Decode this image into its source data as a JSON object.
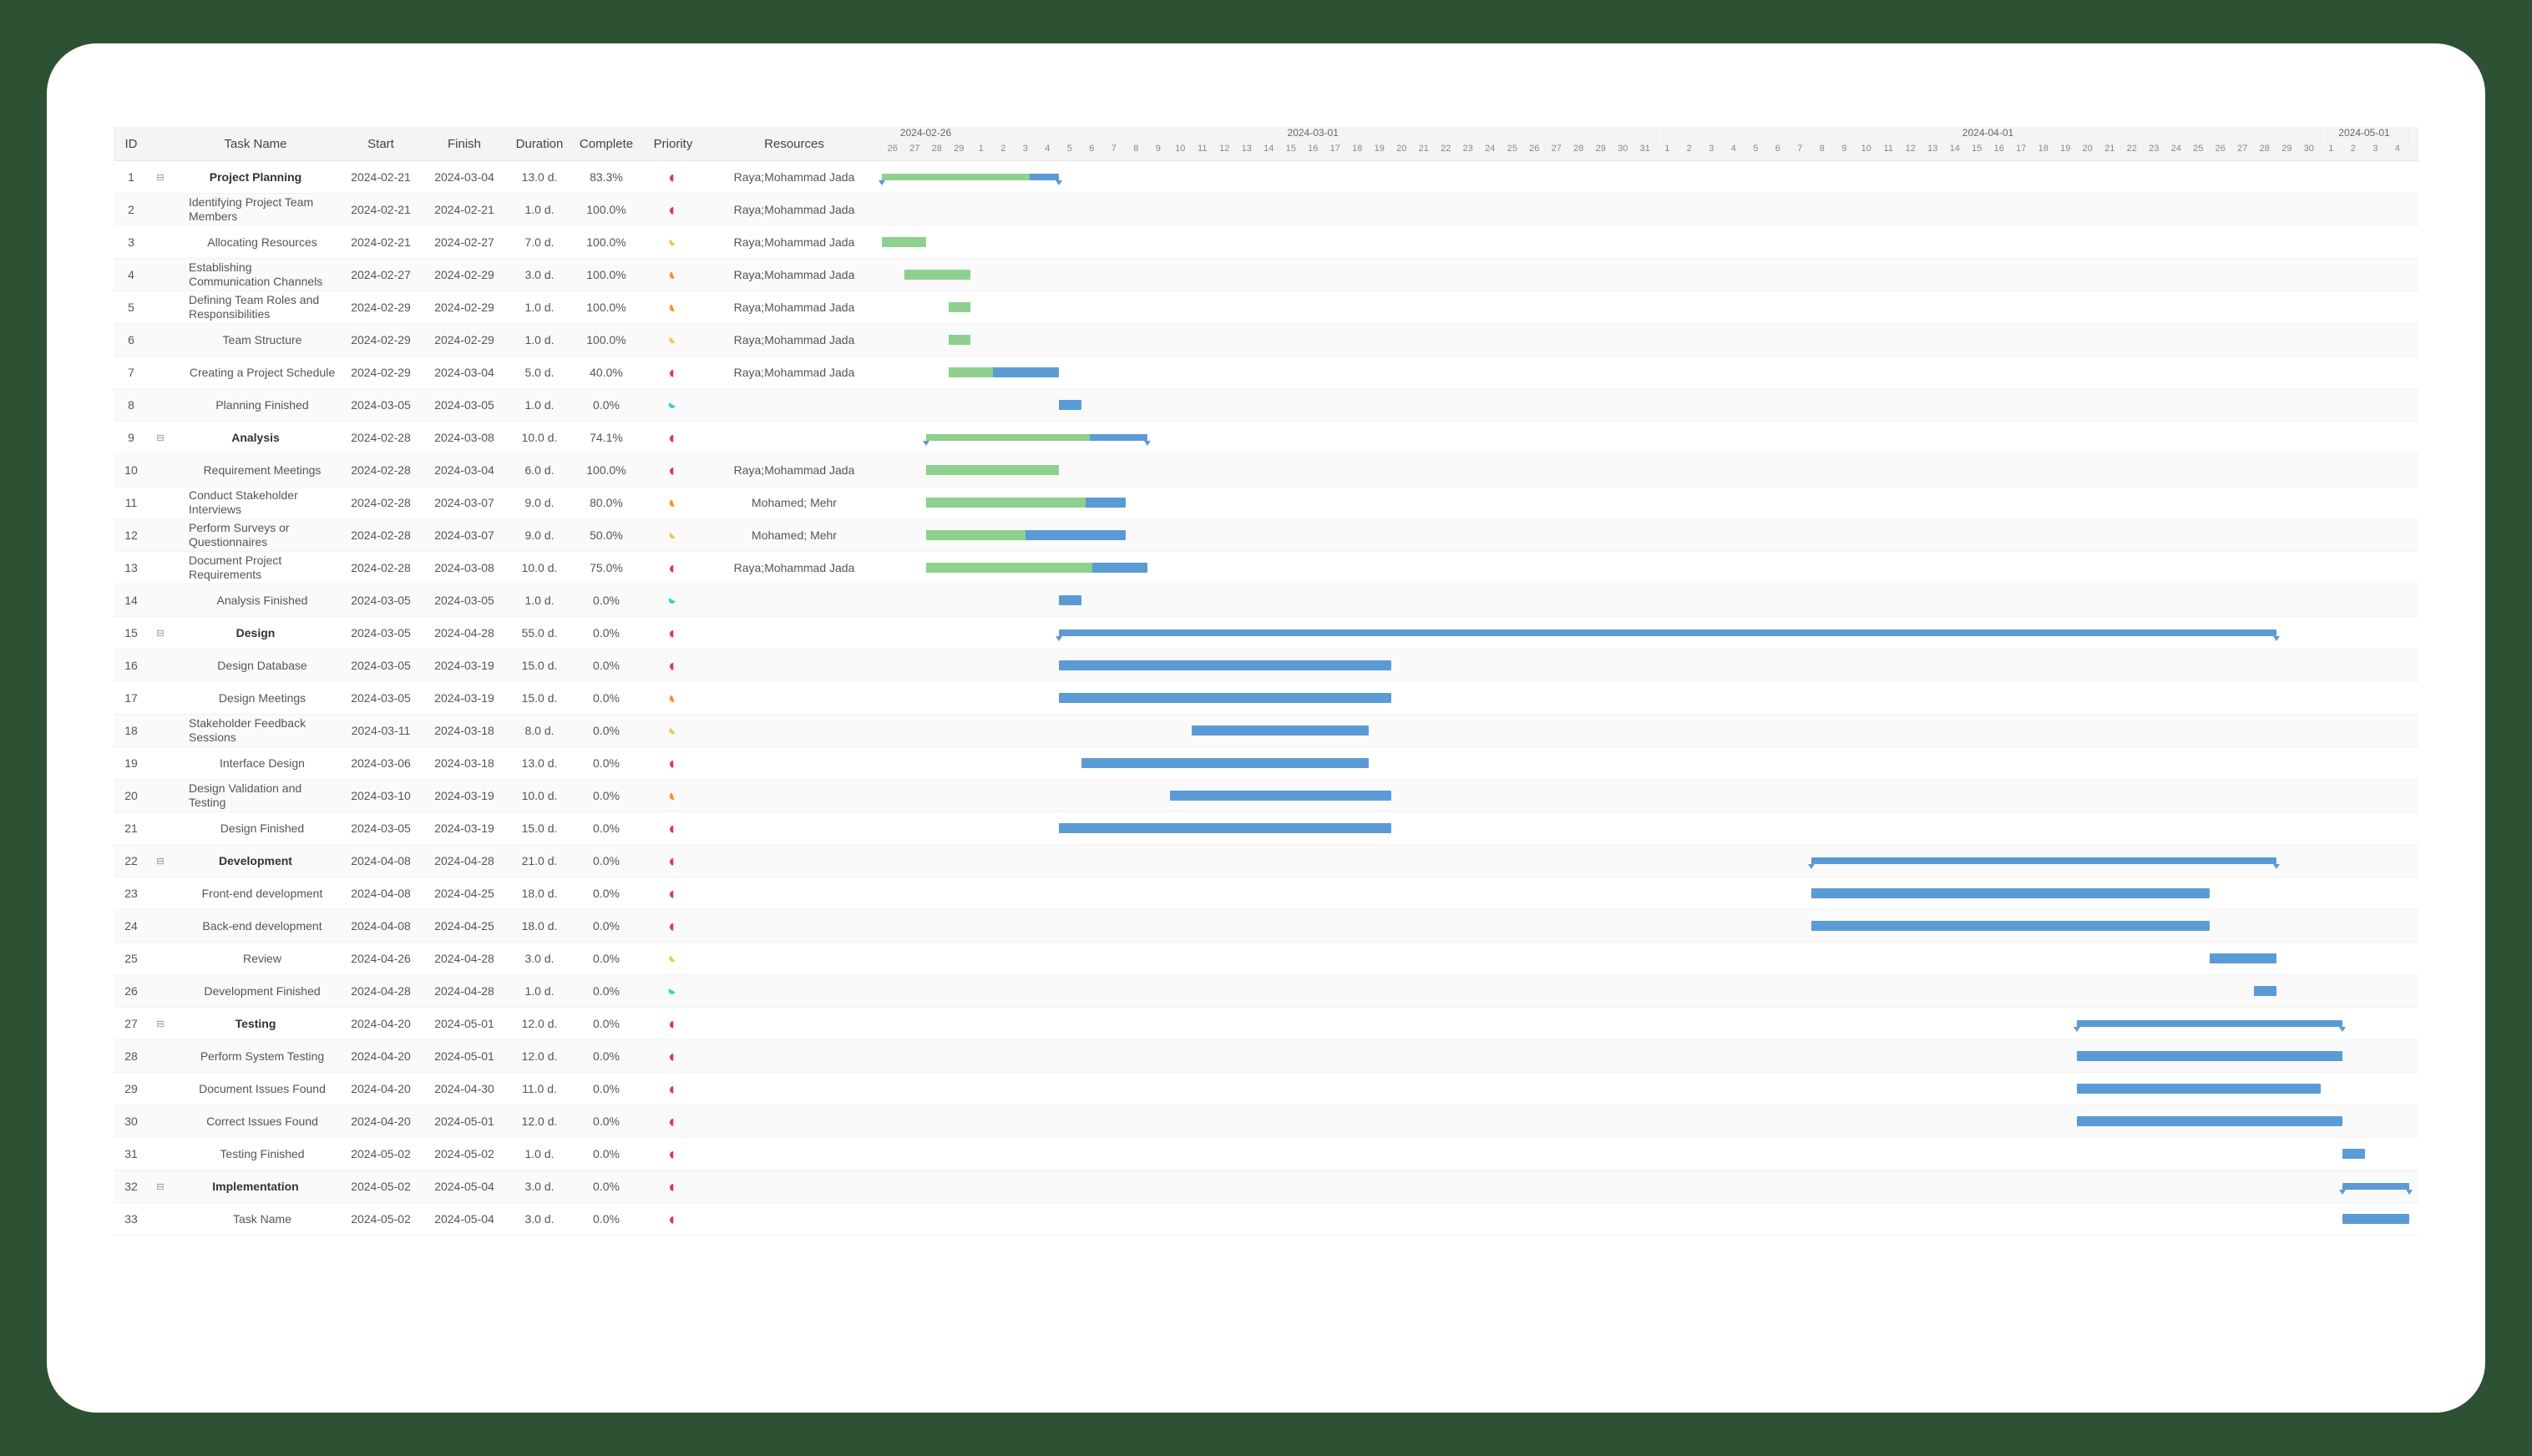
{
  "chart_data": {
    "type": "gantt",
    "timeline_start": "2024-02-26",
    "timeline_end": "2024-05-04",
    "months": [
      "2024-02-26",
      "2024-03-01",
      "2024-04-01",
      "2024-05-01"
    ],
    "tasks": [
      {
        "id": 1,
        "name": "Project Planning",
        "start": "2024-02-21",
        "finish": "2024-03-04",
        "duration": "13.0 d.",
        "complete": "83.3%",
        "priority": "red",
        "resources": "Raya;Mohammad Jada",
        "indent": 0,
        "bold": true,
        "expand": true,
        "summary": true,
        "progress": 0.833
      },
      {
        "id": 2,
        "name": "Identifying Project Team Members",
        "start": "2024-02-21",
        "finish": "2024-02-21",
        "duration": "1.0 d.",
        "complete": "100.0%",
        "priority": "red",
        "resources": "Raya;Mohammad Jada",
        "indent": 1,
        "progress": 1.0
      },
      {
        "id": 3,
        "name": "Allocating Resources",
        "start": "2024-02-21",
        "finish": "2024-02-27",
        "duration": "7.0 d.",
        "complete": "100.0%",
        "priority": "yellow",
        "resources": "Raya;Mohammad Jada",
        "indent": 1,
        "progress": 1.0
      },
      {
        "id": 4,
        "name": "Establishing Communication Channels",
        "start": "2024-02-27",
        "finish": "2024-02-29",
        "duration": "3.0 d.",
        "complete": "100.0%",
        "priority": "orange",
        "resources": "Raya;Mohammad Jada",
        "indent": 1,
        "progress": 1.0
      },
      {
        "id": 5,
        "name": "Defining Team Roles and Responsibilities",
        "start": "2024-02-29",
        "finish": "2024-02-29",
        "duration": "1.0 d.",
        "complete": "100.0%",
        "priority": "orange",
        "resources": "Raya;Mohammad Jada",
        "indent": 1,
        "progress": 1.0
      },
      {
        "id": 6,
        "name": "Team Structure",
        "start": "2024-02-29",
        "finish": "2024-02-29",
        "duration": "1.0 d.",
        "complete": "100.0%",
        "priority": "yellow",
        "resources": "Raya;Mohammad Jada",
        "indent": 1,
        "progress": 1.0
      },
      {
        "id": 7,
        "name": "Creating a Project Schedule",
        "start": "2024-02-29",
        "finish": "2024-03-04",
        "duration": "5.0 d.",
        "complete": "40.0%",
        "priority": "red",
        "resources": "Raya;Mohammad Jada",
        "indent": 1,
        "progress": 0.4
      },
      {
        "id": 8,
        "name": "Planning Finished",
        "start": "2024-03-05",
        "finish": "2024-03-05",
        "duration": "1.0 d.",
        "complete": "0.0%",
        "priority": "cyan",
        "resources": "",
        "indent": 1,
        "progress": 0.0
      },
      {
        "id": 9,
        "name": "Analysis",
        "start": "2024-02-28",
        "finish": "2024-03-08",
        "duration": "10.0 d.",
        "complete": "74.1%",
        "priority": "red",
        "resources": "",
        "indent": 0,
        "bold": true,
        "expand": true,
        "summary": true,
        "progress": 0.741
      },
      {
        "id": 10,
        "name": "Requirement Meetings",
        "start": "2024-02-28",
        "finish": "2024-03-04",
        "duration": "6.0 d.",
        "complete": "100.0%",
        "priority": "red",
        "resources": "Raya;Mohammad Jada",
        "indent": 1,
        "progress": 1.0
      },
      {
        "id": 11,
        "name": "Conduct Stakeholder Interviews",
        "start": "2024-02-28",
        "finish": "2024-03-07",
        "duration": "9.0 d.",
        "complete": "80.0%",
        "priority": "orange",
        "resources": "Mohamed; Mehr",
        "indent": 1,
        "progress": 0.8
      },
      {
        "id": 12,
        "name": "Perform Surveys or Questionnaires",
        "start": "2024-02-28",
        "finish": "2024-03-07",
        "duration": "9.0 d.",
        "complete": "50.0%",
        "priority": "yellow",
        "resources": "Mohamed; Mehr",
        "indent": 1,
        "progress": 0.5
      },
      {
        "id": 13,
        "name": "Document Project Requirements",
        "start": "2024-02-28",
        "finish": "2024-03-08",
        "duration": "10.0 d.",
        "complete": "75.0%",
        "priority": "red",
        "resources": "Raya;Mohammad Jada",
        "indent": 1,
        "progress": 0.75
      },
      {
        "id": 14,
        "name": "Analysis Finished",
        "start": "2024-03-05",
        "finish": "2024-03-05",
        "duration": "1.0 d.",
        "complete": "0.0%",
        "priority": "cyan",
        "resources": "",
        "indent": 1,
        "progress": 0.0
      },
      {
        "id": 15,
        "name": "Design",
        "start": "2024-03-05",
        "finish": "2024-04-28",
        "duration": "55.0 d.",
        "complete": "0.0%",
        "priority": "red",
        "resources": "",
        "indent": 0,
        "bold": true,
        "expand": true,
        "summary": true,
        "progress": 0.0
      },
      {
        "id": 16,
        "name": "Design Database",
        "start": "2024-03-05",
        "finish": "2024-03-19",
        "duration": "15.0 d.",
        "complete": "0.0%",
        "priority": "red",
        "resources": "",
        "indent": 1,
        "progress": 0.0
      },
      {
        "id": 17,
        "name": "Design Meetings",
        "start": "2024-03-05",
        "finish": "2024-03-19",
        "duration": "15.0 d.",
        "complete": "0.0%",
        "priority": "orange",
        "resources": "",
        "indent": 1,
        "progress": 0.0
      },
      {
        "id": 18,
        "name": "Stakeholder Feedback Sessions",
        "start": "2024-03-11",
        "finish": "2024-03-18",
        "duration": "8.0 d.",
        "complete": "0.0%",
        "priority": "yellow",
        "resources": "",
        "indent": 1,
        "progress": 0.0
      },
      {
        "id": 19,
        "name": "Interface Design",
        "start": "2024-03-06",
        "finish": "2024-03-18",
        "duration": "13.0 d.",
        "complete": "0.0%",
        "priority": "red",
        "resources": "",
        "indent": 1,
        "progress": 0.0
      },
      {
        "id": 20,
        "name": "Design Validation and Testing",
        "start": "2024-03-10",
        "finish": "2024-03-19",
        "duration": "10.0 d.",
        "complete": "0.0%",
        "priority": "orange",
        "resources": "",
        "indent": 1,
        "progress": 0.0
      },
      {
        "id": 21,
        "name": "Design Finished",
        "start": "2024-03-05",
        "finish": "2024-03-19",
        "duration": "15.0 d.",
        "complete": "0.0%",
        "priority": "red",
        "resources": "",
        "indent": 1,
        "progress": 0.0
      },
      {
        "id": 22,
        "name": "Development",
        "start": "2024-04-08",
        "finish": "2024-04-28",
        "duration": "21.0 d.",
        "complete": "0.0%",
        "priority": "red",
        "resources": "",
        "indent": 0,
        "bold": true,
        "expand": true,
        "summary": true,
        "progress": 0.0
      },
      {
        "id": 23,
        "name": "Front-end development",
        "start": "2024-04-08",
        "finish": "2024-04-25",
        "duration": "18.0 d.",
        "complete": "0.0%",
        "priority": "red",
        "resources": "",
        "indent": 1,
        "progress": 0.0
      },
      {
        "id": 24,
        "name": "Back-end development",
        "start": "2024-04-08",
        "finish": "2024-04-25",
        "duration": "18.0 d.",
        "complete": "0.0%",
        "priority": "red",
        "resources": "",
        "indent": 1,
        "progress": 0.0
      },
      {
        "id": 25,
        "name": "Review",
        "start": "2024-04-26",
        "finish": "2024-04-28",
        "duration": "3.0 d.",
        "complete": "0.0%",
        "priority": "yellow",
        "resources": "",
        "indent": 1,
        "progress": 0.0
      },
      {
        "id": 26,
        "name": "Development Finished",
        "start": "2024-04-28",
        "finish": "2024-04-28",
        "duration": "1.0 d.",
        "complete": "0.0%",
        "priority": "cyan",
        "resources": "",
        "indent": 1,
        "progress": 0.0
      },
      {
        "id": 27,
        "name": "Testing",
        "start": "2024-04-20",
        "finish": "2024-05-01",
        "duration": "12.0 d.",
        "complete": "0.0%",
        "priority": "red",
        "resources": "",
        "indent": 0,
        "bold": true,
        "expand": true,
        "summary": true,
        "progress": 0.0
      },
      {
        "id": 28,
        "name": "Perform System Testing",
        "start": "2024-04-20",
        "finish": "2024-05-01",
        "duration": "12.0 d.",
        "complete": "0.0%",
        "priority": "red",
        "resources": "",
        "indent": 1,
        "progress": 0.0
      },
      {
        "id": 29,
        "name": "Document Issues Found",
        "start": "2024-04-20",
        "finish": "2024-04-30",
        "duration": "11.0 d.",
        "complete": "0.0%",
        "priority": "red",
        "resources": "",
        "indent": 1,
        "progress": 0.0
      },
      {
        "id": 30,
        "name": "Correct Issues Found",
        "start": "2024-04-20",
        "finish": "2024-05-01",
        "duration": "12.0 d.",
        "complete": "0.0%",
        "priority": "red",
        "resources": "",
        "indent": 1,
        "progress": 0.0
      },
      {
        "id": 31,
        "name": "Testing Finished",
        "start": "2024-05-02",
        "finish": "2024-05-02",
        "duration": "1.0 d.",
        "complete": "0.0%",
        "priority": "red",
        "resources": "",
        "indent": 1,
        "progress": 0.0
      },
      {
        "id": 32,
        "name": "Implementation",
        "start": "2024-05-02",
        "finish": "2024-05-04",
        "duration": "3.0 d.",
        "complete": "0.0%",
        "priority": "red",
        "resources": "",
        "indent": 0,
        "bold": true,
        "expand": true,
        "summary": true,
        "progress": 0.0
      },
      {
        "id": 33,
        "name": "Task Name",
        "start": "2024-05-02",
        "finish": "2024-05-04",
        "duration": "3.0 d.",
        "complete": "0.0%",
        "priority": "red",
        "resources": "",
        "indent": 1,
        "progress": 0.0
      }
    ]
  },
  "columns": {
    "id": "ID",
    "task": "Task Name",
    "start": "Start",
    "finish": "Finish",
    "duration": "Duration",
    "complete": "Complete",
    "priority": "Priority",
    "resources": "Resources"
  }
}
